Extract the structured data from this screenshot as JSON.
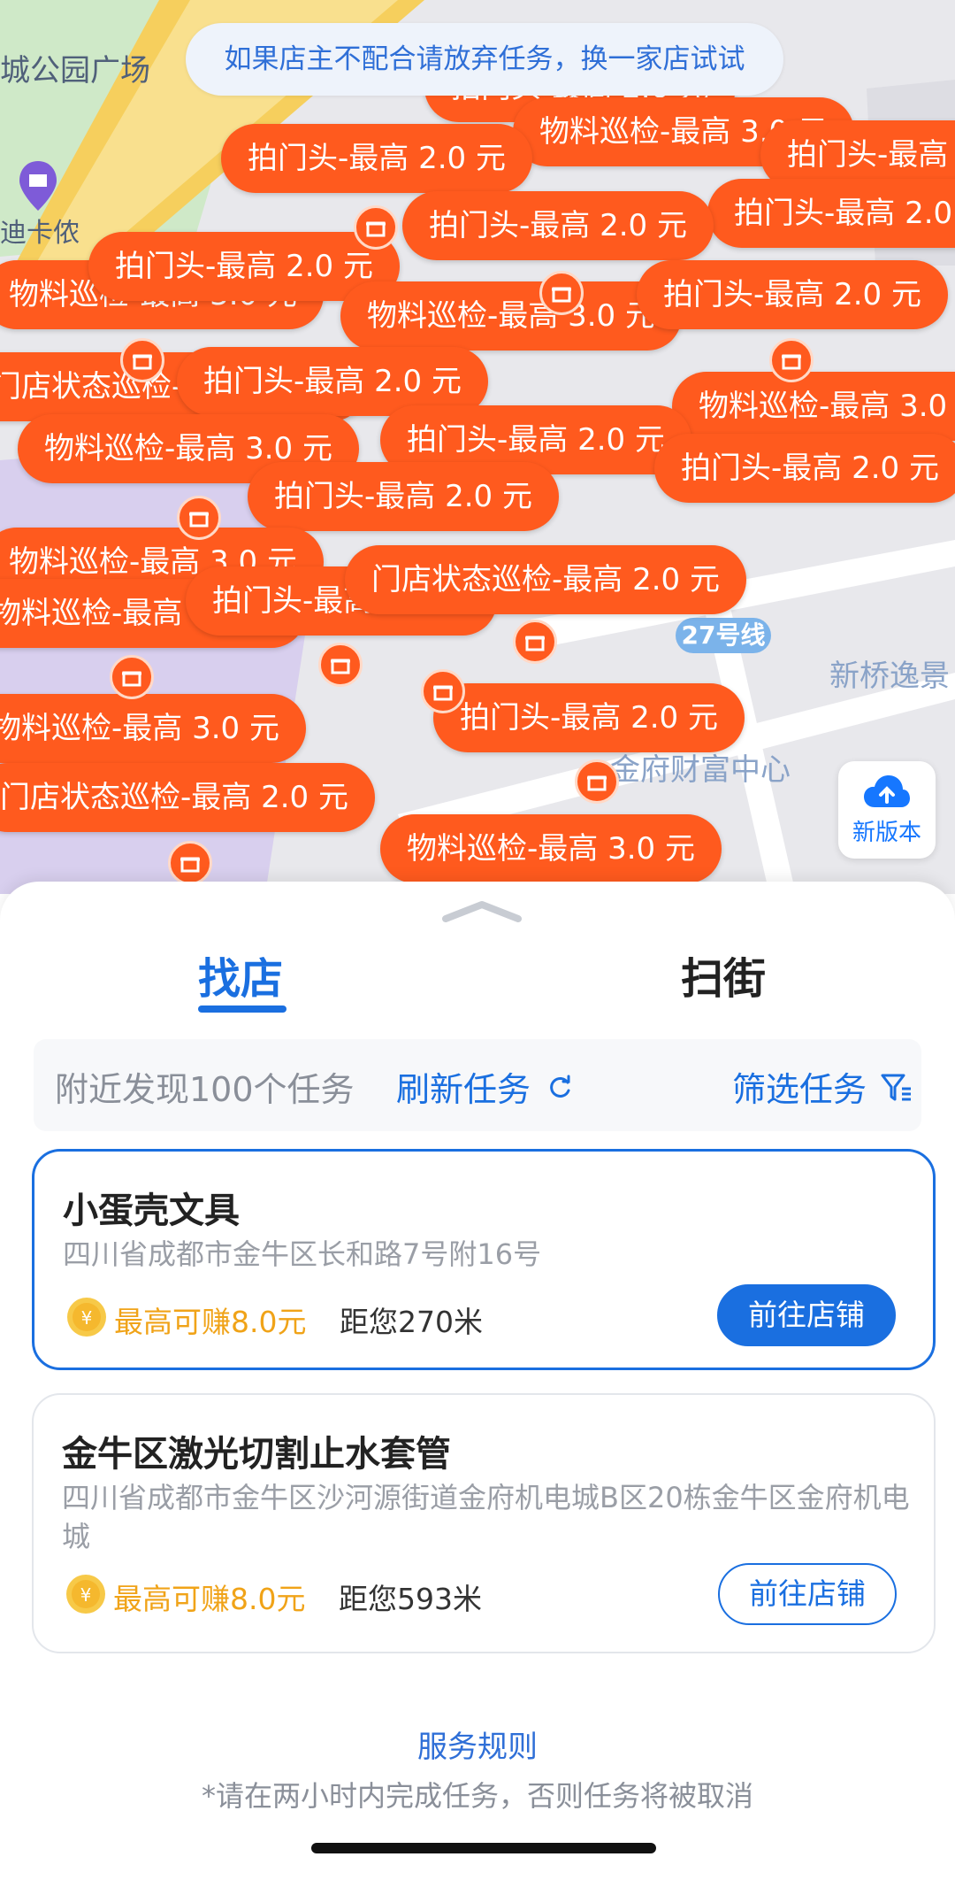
{
  "map": {
    "labels": [
      "城公园广场",
      "迪卡侬",
      "新桥逸景",
      "金府财富中心",
      "27号线"
    ],
    "tip": "如果店主不配合请放弃任务，换一家店试试",
    "new_version": "新版本",
    "bubbles": [
      "拍门头-最高 2.0 元",
      "物料巡检-最高 3.0 元",
      "拍门头-最高 2.0 元",
      "拍门头-最高 2.0 元",
      "拍门头-最高 2.0 元",
      "拍门头-最高 2.0 元",
      "物料巡检-最高 3.0 元",
      "拍门头-最高 2.0 元",
      "物料巡检-最高 3.0 元",
      "拍门头-最高 2.0 元",
      "门店状态巡检-最高 2.0 元",
      "拍门头-最高 2.0 元",
      "门店状态巡检-最高 2.0 元",
      "物料巡检-最高 3.0 元",
      "物料巡检-最高 3.0 元",
      "拍门头-最高 2.0 元",
      "物料巡检-最高 3.0 元",
      "门店状态巡检-最高 2.0 元",
      "物料巡检-最高 3.0 元"
    ]
  },
  "tabs": {
    "find_store": "找店",
    "sweep_street": "扫街"
  },
  "summary": {
    "count_text": "附近发现100个任务",
    "refresh": "刷新任务",
    "filter": "筛选任务"
  },
  "stores": [
    {
      "name": "小蛋壳文具",
      "address": "四川省成都市金牛区长和路7号附16号",
      "earn": "最高可赚8.0元",
      "distance": "距您270米",
      "action": "前往店铺"
    },
    {
      "name": "金牛区激光切割止水套管",
      "address": "四川省成都市金牛区沙河源街道金府机电城B区20栋金牛区金府机电城",
      "earn": "最高可赚8.0元",
      "distance": "距您593米",
      "action": "前往店铺"
    }
  ],
  "footer": {
    "rules": "服务规则",
    "notice": "*请在两小时内完成任务，否则任务将被取消"
  },
  "colors": {
    "accent": "#1a6fe0",
    "bubble": "#ff5a1e",
    "earn": "#f0a318"
  }
}
